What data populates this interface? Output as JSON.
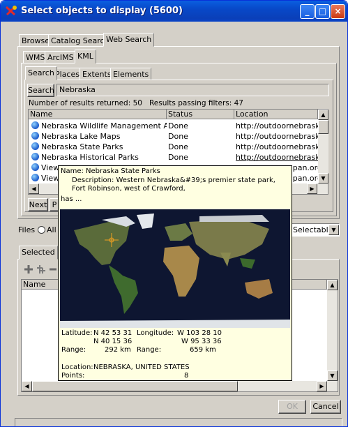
{
  "window": {
    "title": "Select objects to display (5600)",
    "controls": {
      "minimize": "_",
      "maximize": "□",
      "close": "×"
    }
  },
  "top_tabs": [
    "Browse",
    "Catalog Search",
    "Web Search"
  ],
  "service_tabs": [
    "WMS",
    "ArcIMS",
    "KML"
  ],
  "search_tabs": [
    "Search",
    "Places",
    "Extents",
    "Elements"
  ],
  "search": {
    "button": "Search",
    "query": "Nebraska"
  },
  "results_summary": "Number of results returned: 50   Results passing filters: 47",
  "results_table": {
    "columns": [
      "Name",
      "Status",
      "Location"
    ],
    "rows": [
      {
        "name": "Nebraska Wildlife Management Areas",
        "status": "Done",
        "location": "http://outdoornebraska.n"
      },
      {
        "name": "Nebraska Lake Maps",
        "status": "Done",
        "location": "http://outdoornebraska.n"
      },
      {
        "name": "Nebraska State Parks",
        "status": "Done",
        "location": "http://outdoornebraska.n"
      },
      {
        "name": "Nebraska Historical Parks",
        "status": "Done",
        "location": "http://outdoornebraska.n"
      },
      {
        "name": "View",
        "status": "",
        "location": "apan.org/"
      },
      {
        "name": "View",
        "status": "",
        "location": "apan.org/"
      }
    ]
  },
  "nav": {
    "next": "Next",
    "prev_partial": "P"
  },
  "files": {
    "label": "Files",
    "radio_label": "All",
    "selectable_label": "Selectable"
  },
  "lower_tabs": [
    "Selected",
    ""
  ],
  "lower_table": {
    "column": "Name"
  },
  "tooltip": {
    "name_line": "Name: Nebraska State Parks",
    "description": "Description: Western Nebraska&#39;s premier state park, Fort Robinson, west of Crawford,",
    "has": "has ...",
    "latitude_label": "Latitude:",
    "latitude_1": "N 42 53 31",
    "latitude_2": "N 40 15 36",
    "longitude_label": "Longitude:",
    "longitude_1": "W 103 28 10",
    "longitude_2": "W 95 33 36",
    "range_label": "Range:",
    "range_lat": "292 km",
    "range_label2": "Range:",
    "range_lon": "659 km",
    "location_label": "Location:",
    "location_value": "NEBRASKA, UNITED STATES",
    "points_label": "Points:",
    "points_value": "8"
  },
  "buttons": {
    "ok": "OK",
    "cancel": "Cancel"
  }
}
